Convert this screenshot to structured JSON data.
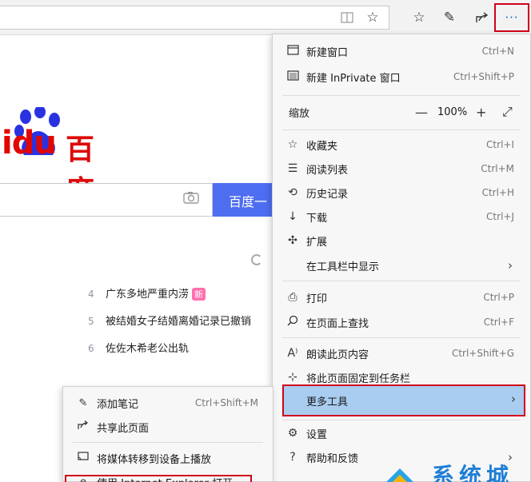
{
  "toolbar": {
    "icons": [
      "reading-view-icon",
      "favorite-star-icon",
      "favorites-icon",
      "pen-icon",
      "share-icon",
      "more-icon"
    ],
    "more_label": "···"
  },
  "page": {
    "logo_latin": "idu",
    "logo_cn": "百度",
    "search_button": "百度一",
    "hot_items": [
      {
        "num": "4",
        "text": "广东多地严重内涝",
        "tag": "新"
      },
      {
        "num": "5",
        "text": "被结婚女子结婚离婚记录已撤销",
        "tag": ""
      },
      {
        "num": "6",
        "text": "佐佐木希老公出轨",
        "tag": ""
      }
    ]
  },
  "menu": {
    "new_window": {
      "label": "新建窗口",
      "shortcut": "Ctrl+N"
    },
    "new_inprivate": {
      "label": "新建 InPrivate 窗口",
      "shortcut": "Ctrl+Shift+P"
    },
    "zoom": {
      "label": "缩放",
      "minus": "—",
      "value": "100%",
      "plus": "+",
      "fullscreen": "⤢"
    },
    "favorites": {
      "label": "收藏夹",
      "shortcut": "Ctrl+I"
    },
    "reading_list": {
      "label": "阅读列表",
      "shortcut": "Ctrl+M"
    },
    "history": {
      "label": "历史记录",
      "shortcut": "Ctrl+H"
    },
    "downloads": {
      "label": "下载",
      "shortcut": "Ctrl+J"
    },
    "extensions": {
      "label": "扩展"
    },
    "show_in_toolbar": {
      "label": "在工具栏中显示"
    },
    "print": {
      "label": "打印",
      "shortcut": "Ctrl+P"
    },
    "find": {
      "label": "在页面上查找",
      "shortcut": "Ctrl+F"
    },
    "read_aloud": {
      "label": "朗读此页内容",
      "shortcut": "Ctrl+Shift+G"
    },
    "pin_taskbar": {
      "label": "将此页面固定到任务栏"
    },
    "more_tools": {
      "label": "更多工具"
    },
    "settings": {
      "label": "设置"
    },
    "help": {
      "label": "帮助和反馈"
    }
  },
  "submenu": {
    "add_notes": {
      "label": "添加笔记",
      "shortcut": "Ctrl+Shift+M"
    },
    "share": {
      "label": "共享此页面"
    },
    "cast": {
      "label": "将媒体转移到设备上播放"
    },
    "open_ie": {
      "label": "使用 Internet Explorer 打开"
    }
  },
  "watermark": {
    "text": "系统城"
  },
  "colors": {
    "highlight": "#a9cdf0",
    "annotation": "#d0021b",
    "accent": "#4e6ef2"
  }
}
